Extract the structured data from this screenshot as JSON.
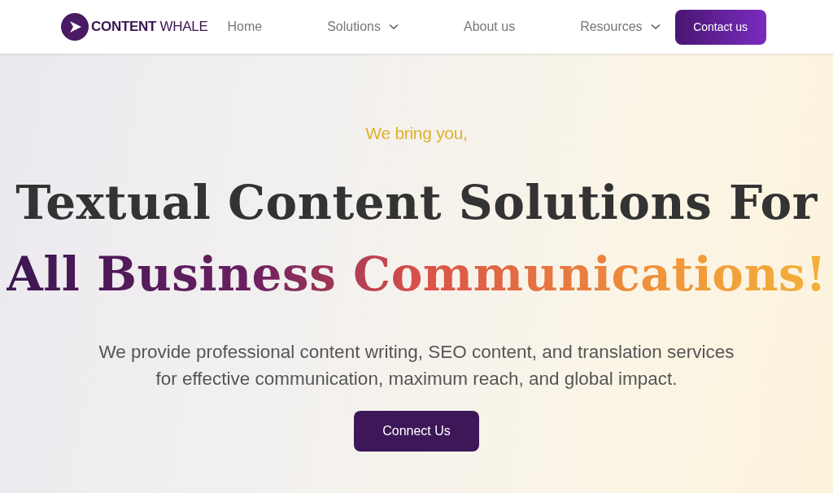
{
  "header": {
    "logo": {
      "bold": "CONTENT",
      "light": "WHALE"
    },
    "nav": [
      {
        "label": "Home",
        "has_dropdown": false
      },
      {
        "label": "Solutions",
        "has_dropdown": true
      },
      {
        "label": "About us",
        "has_dropdown": false
      },
      {
        "label": "Resources",
        "has_dropdown": true
      }
    ],
    "cta": "Contact us"
  },
  "hero": {
    "eyebrow": "We bring you,",
    "headline_line1": "Textual Content Solutions For",
    "headline_line2": "All Business Communications!",
    "description": [
      "We provide professional content writing, SEO content, and translation services",
      "for effective communication, maximum reach, and global impact."
    ],
    "button": "Connect Us"
  }
}
